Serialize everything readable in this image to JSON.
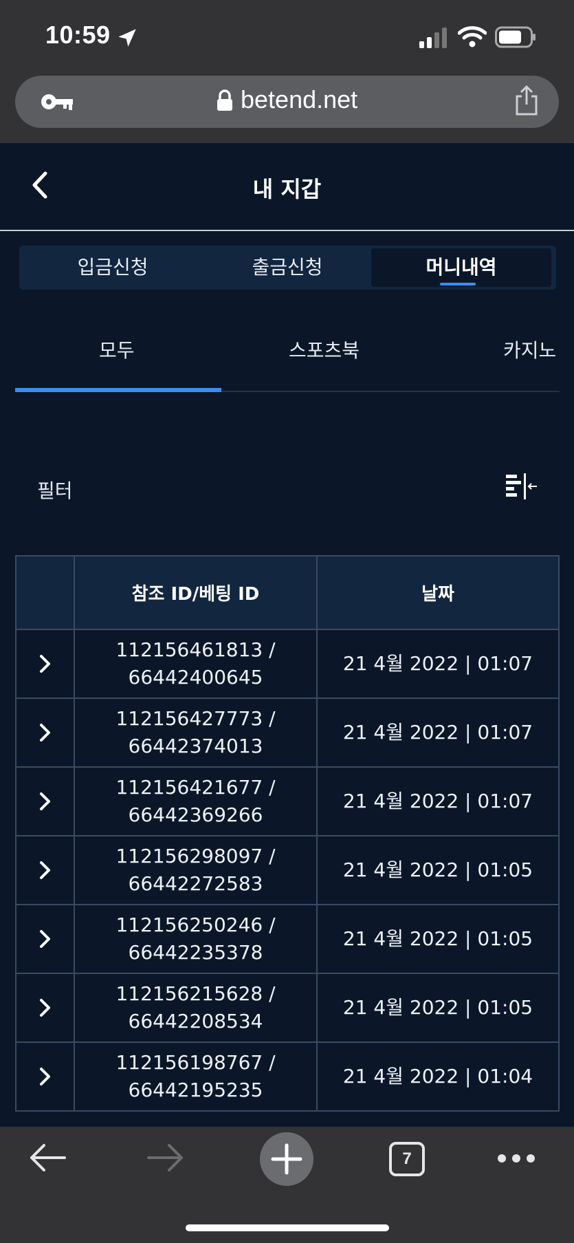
{
  "status_bar": {
    "time": "10:59"
  },
  "browser": {
    "url": "betend.net",
    "tab_count": "7"
  },
  "header": {
    "title": "내 지갑"
  },
  "main_tabs": [
    {
      "label": "입금신청",
      "active": false
    },
    {
      "label": "출금신청",
      "active": false
    },
    {
      "label": "머니내역",
      "active": true
    }
  ],
  "sub_tabs": [
    {
      "label": "모두",
      "active": true
    },
    {
      "label": "스포츠북",
      "active": false
    },
    {
      "label": "카지노",
      "active": false
    }
  ],
  "filter": {
    "label": "필터"
  },
  "table": {
    "columns": [
      "",
      "참조 ID/베팅 ID",
      "날짜"
    ],
    "rows": [
      {
        "ref_id": "112156461813 /",
        "bet_id": "66442400645",
        "date": "21 4월 2022 | 01:07"
      },
      {
        "ref_id": "112156427773 /",
        "bet_id": "66442374013",
        "date": "21 4월 2022 | 01:07"
      },
      {
        "ref_id": "112156421677 /",
        "bet_id": "66442369266",
        "date": "21 4월 2022 | 01:07"
      },
      {
        "ref_id": "112156298097 /",
        "bet_id": "66442272583",
        "date": "21 4월 2022 | 01:05"
      },
      {
        "ref_id": "112156250246 /",
        "bet_id": "66442235378",
        "date": "21 4월 2022 | 01:05"
      },
      {
        "ref_id": "112156215628 /",
        "bet_id": "66442208534",
        "date": "21 4월 2022 | 01:05"
      },
      {
        "ref_id": "112156198767 /",
        "bet_id": "66442195235",
        "date": "21 4월 2022 | 01:04"
      }
    ]
  },
  "colors": {
    "background": "#0b1729",
    "panel": "#132640",
    "accent": "#3b8ef0",
    "chrome": "#333335"
  }
}
